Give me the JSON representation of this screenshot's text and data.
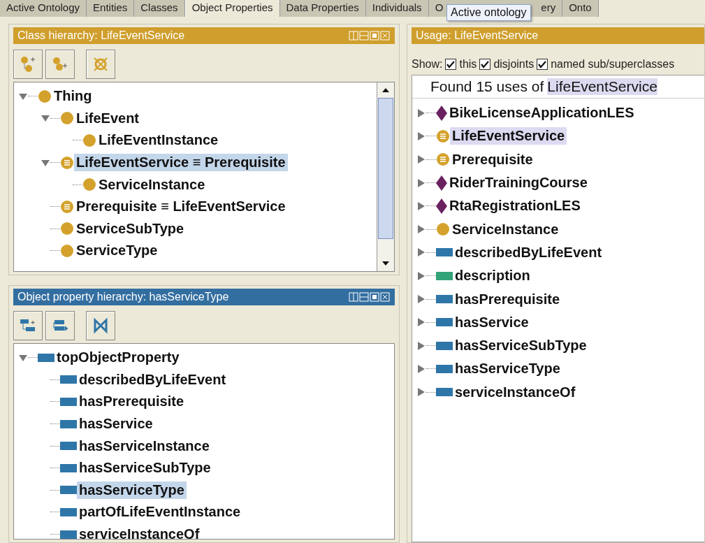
{
  "tabs": [
    {
      "label": "Active Ontology",
      "selected": false
    },
    {
      "label": "Entities",
      "selected": false
    },
    {
      "label": "Classes",
      "selected": false
    },
    {
      "label": "Object Properties",
      "selected": true
    },
    {
      "label": "Data Properties",
      "selected": false
    },
    {
      "label": "Individuals",
      "selected": false
    },
    {
      "label": "O",
      "label_end": "ery",
      "selected": false
    },
    {
      "label": "Onto",
      "selected": false
    }
  ],
  "tooltip": "Active ontology",
  "class_hierarchy": {
    "title": "Class hierarchy: LifeEventService",
    "color": "#cf9e2c",
    "tree": [
      {
        "label": "Thing",
        "kind": "class",
        "expanded": true,
        "selected": false,
        "children": [
          {
            "label": "LifeEvent",
            "kind": "class",
            "expanded": true,
            "selected": false,
            "children": [
              {
                "label": "LifeEventInstance",
                "kind": "class",
                "selected": false
              }
            ]
          },
          {
            "label": "LifeEventService ≡ Prerequisite",
            "kind": "defined",
            "expanded": true,
            "selected": true,
            "children": [
              {
                "label": "ServiceInstance",
                "kind": "class",
                "selected": false
              }
            ]
          },
          {
            "label": "Prerequisite ≡ LifeEventService",
            "kind": "defined",
            "selected": false
          },
          {
            "label": "ServiceSubType",
            "kind": "class",
            "selected": false
          },
          {
            "label": "ServiceType",
            "kind": "class",
            "selected": false
          }
        ]
      }
    ]
  },
  "object_property_hierarchy": {
    "title": "Object property hierarchy: hasServiceType",
    "color": "#336ea0",
    "tree": [
      {
        "label": "topObjectProperty",
        "kind": "objprop",
        "expanded": true,
        "selected": false,
        "children": [
          {
            "label": "describedByLifeEvent",
            "kind": "objprop",
            "selected": false
          },
          {
            "label": "hasPrerequisite",
            "kind": "objprop",
            "selected": false
          },
          {
            "label": "hasService",
            "kind": "objprop",
            "selected": false
          },
          {
            "label": "hasServiceInstance",
            "kind": "objprop",
            "selected": false
          },
          {
            "label": "hasServiceSubType",
            "kind": "objprop",
            "selected": false
          },
          {
            "label": "hasServiceType",
            "kind": "objprop",
            "selected": true
          },
          {
            "label": "partOfLifeEventInstance",
            "kind": "objprop",
            "selected": false
          },
          {
            "label": "serviceInstanceOf",
            "kind": "objprop",
            "selected": false
          }
        ]
      }
    ]
  },
  "usage": {
    "title": "Usage: LifeEventService",
    "color": "#cf9e2c",
    "show_label": "Show:",
    "options": [
      {
        "label": "this",
        "checked": true
      },
      {
        "label": "disjoints",
        "checked": true
      },
      {
        "label": "named sub/superclasses",
        "checked": true
      }
    ],
    "found_prefix": "Found 15 uses of",
    "found_name": "LifeEventService",
    "items": [
      {
        "label": "BikeLicenseApplicationLES",
        "kind": "individual",
        "expanded": false,
        "selected": false
      },
      {
        "label": "LifeEventService",
        "kind": "defined",
        "expanded": false,
        "selected": true
      },
      {
        "label": "Prerequisite",
        "kind": "defined",
        "expanded": false,
        "selected": false
      },
      {
        "label": "RiderTrainingCourse",
        "kind": "individual",
        "expanded": false,
        "selected": false
      },
      {
        "label": "RtaRegistrationLES",
        "kind": "individual",
        "expanded": false,
        "selected": false
      },
      {
        "label": "ServiceInstance",
        "kind": "class",
        "expanded": false,
        "selected": false
      },
      {
        "label": "describedByLifeEvent",
        "kind": "objprop",
        "expanded": false,
        "selected": false
      },
      {
        "label": "description",
        "kind": "dataprop",
        "expanded": false,
        "selected": false
      },
      {
        "label": "hasPrerequisite",
        "kind": "objprop",
        "expanded": false,
        "selected": false
      },
      {
        "label": "hasService",
        "kind": "objprop",
        "expanded": false,
        "selected": false
      },
      {
        "label": "hasServiceSubType",
        "kind": "objprop",
        "expanded": false,
        "selected": false
      },
      {
        "label": "hasServiceType",
        "kind": "objprop",
        "expanded": false,
        "selected": false
      },
      {
        "label": "serviceInstanceOf",
        "kind": "objprop",
        "expanded": false,
        "selected": false
      }
    ]
  }
}
